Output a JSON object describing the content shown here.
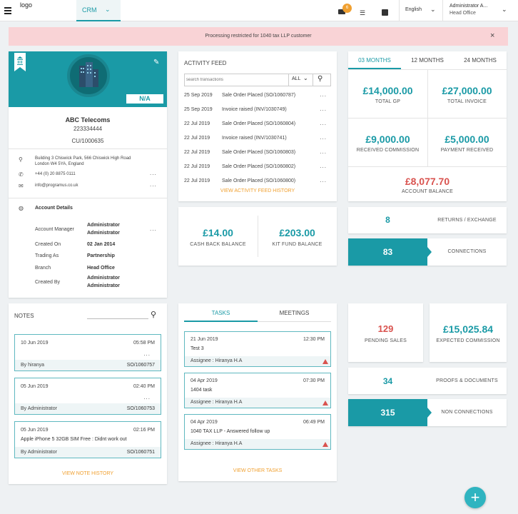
{
  "topbar": {
    "logo": "logo",
    "module": "CRM",
    "notifications_count": "6",
    "language": "English",
    "user_name": "Administrator A...",
    "user_office": "Head Office"
  },
  "alert": {
    "message": "Processing restricted for 1040 tax LLP customer",
    "close": "×"
  },
  "profile": {
    "status": "N/A",
    "company": "ABC Telecoms",
    "number": "223334444",
    "cu": "CU/1000635",
    "address_line1": "Building 3 Chiswick Park, 566 Chiswick High Road",
    "address_line2": "London W4 5YA, England",
    "phone": "+44 (0) 20 8875 0111",
    "email": "info@programus.co.uk",
    "details_title": "Account Details",
    "details": [
      {
        "label": "Account Manager",
        "value1": "Administrator",
        "value2": "Administrator"
      },
      {
        "label": "Created On",
        "value1": "02 Jan 2014"
      },
      {
        "label": "Trading As",
        "value1": "Partnership"
      },
      {
        "label": "Branch",
        "value1": "Head Office"
      },
      {
        "label": "Created By",
        "value1": "Administrator",
        "value2": "Administrator"
      }
    ]
  },
  "activity": {
    "title": "ACTIVITY FEED",
    "search_placeholder": "search transactions",
    "filter": "ALL",
    "items": [
      {
        "date": "25 Sep 2019",
        "text": "Sale Order Placed (SO/1060787)"
      },
      {
        "date": "25 Sep 2019",
        "text": "Invoice raised (INV/1030749)"
      },
      {
        "date": "22 Jul 2019",
        "text": "Sale Order Placed (SO/1060804)"
      },
      {
        "date": "22 Jul 2019",
        "text": "Invoice raised (INV/1030741)"
      },
      {
        "date": "22 Jul 2019",
        "text": "Sale Order Placed (SO/1060803)"
      },
      {
        "date": "22 Jul 2019",
        "text": "Sale Order Placed (SO/1060802)"
      },
      {
        "date": "22 Jul 2019",
        "text": "Sale Order Placed (SO/1060800)"
      }
    ],
    "history_link": "VIEW ACTIVITY FEED HISTORY"
  },
  "balances": {
    "cashback_value": "£14.00",
    "cashback_label": "CASH BACK BALANCE",
    "kitfund_value": "£203.00",
    "kitfund_label": "KIT FUND BALANCE"
  },
  "stats": {
    "tabs": [
      "03 MONTHS",
      "12 MONTHS",
      "24 MONTHS"
    ],
    "total_gp_value": "£14,000.00",
    "total_gp_label": "TOTAL GP",
    "total_invoice_value": "£27,000.00",
    "total_invoice_label": "TOTAL INVOICE",
    "received_commission_value": "£9,000.00",
    "received_commission_label": "RECEIVED COMMISSION",
    "payment_received_value": "£5,000.00",
    "payment_received_label": "PAYMENT RECEIVED",
    "account_balance_value": "£8,077.70",
    "account_balance_label": "ACCOUNT BALANCE"
  },
  "counters": {
    "returns_value": "8",
    "returns_label": "RETURNS / EXCHANGE",
    "connections_value": "83",
    "connections_label": "CONNECTIONS",
    "pending_value": "129",
    "pending_label": "PENDING SALES",
    "expected_value": "£15,025.84",
    "expected_label": "EXPECTED COMMISSION",
    "proofs_value": "34",
    "proofs_label": "PROOFS & DOCUMENTS",
    "nonconn_value": "315",
    "nonconn_label": "NON CONNECTIONS"
  },
  "notes": {
    "title": "NOTES",
    "items": [
      {
        "date": "10 Jun 2019",
        "time": "05:58 PM",
        "text": "",
        "by": "By hiranya",
        "ref": "SO/1060757"
      },
      {
        "date": "05 Jun 2019",
        "time": "02:40 PM",
        "text": "",
        "by": "By Administrator",
        "ref": "SO/1060753"
      },
      {
        "date": "05 Jun 2019",
        "time": "02:16 PM",
        "text": "Apple iPhone 5 32GB SIM Free : Didnt work out",
        "by": "By Administrator",
        "ref": "SO/1060751"
      }
    ],
    "history_link": "VIEW NOTE HISTORY"
  },
  "tasks": {
    "tab_tasks": "TASKS",
    "tab_meetings": "MEETINGS",
    "items": [
      {
        "date": "21 Jun 2019",
        "time": "12:30 PM",
        "title": "Test 3",
        "assignee": "Assignee : Hiranya H.A"
      },
      {
        "date": "04 Apr 2019",
        "time": "07:30 PM",
        "title": "1404 task",
        "assignee": "Assignee : Hiranya H.A"
      },
      {
        "date": "04 Apr 2019",
        "time": "06:49 PM",
        "title": "1040 TAX LLP - Answered follow up",
        "assignee": "Assignee : Hiranya H.A"
      }
    ],
    "other_link": "VIEW OTHER TASKS"
  },
  "more_dots": "...",
  "fab": "+"
}
